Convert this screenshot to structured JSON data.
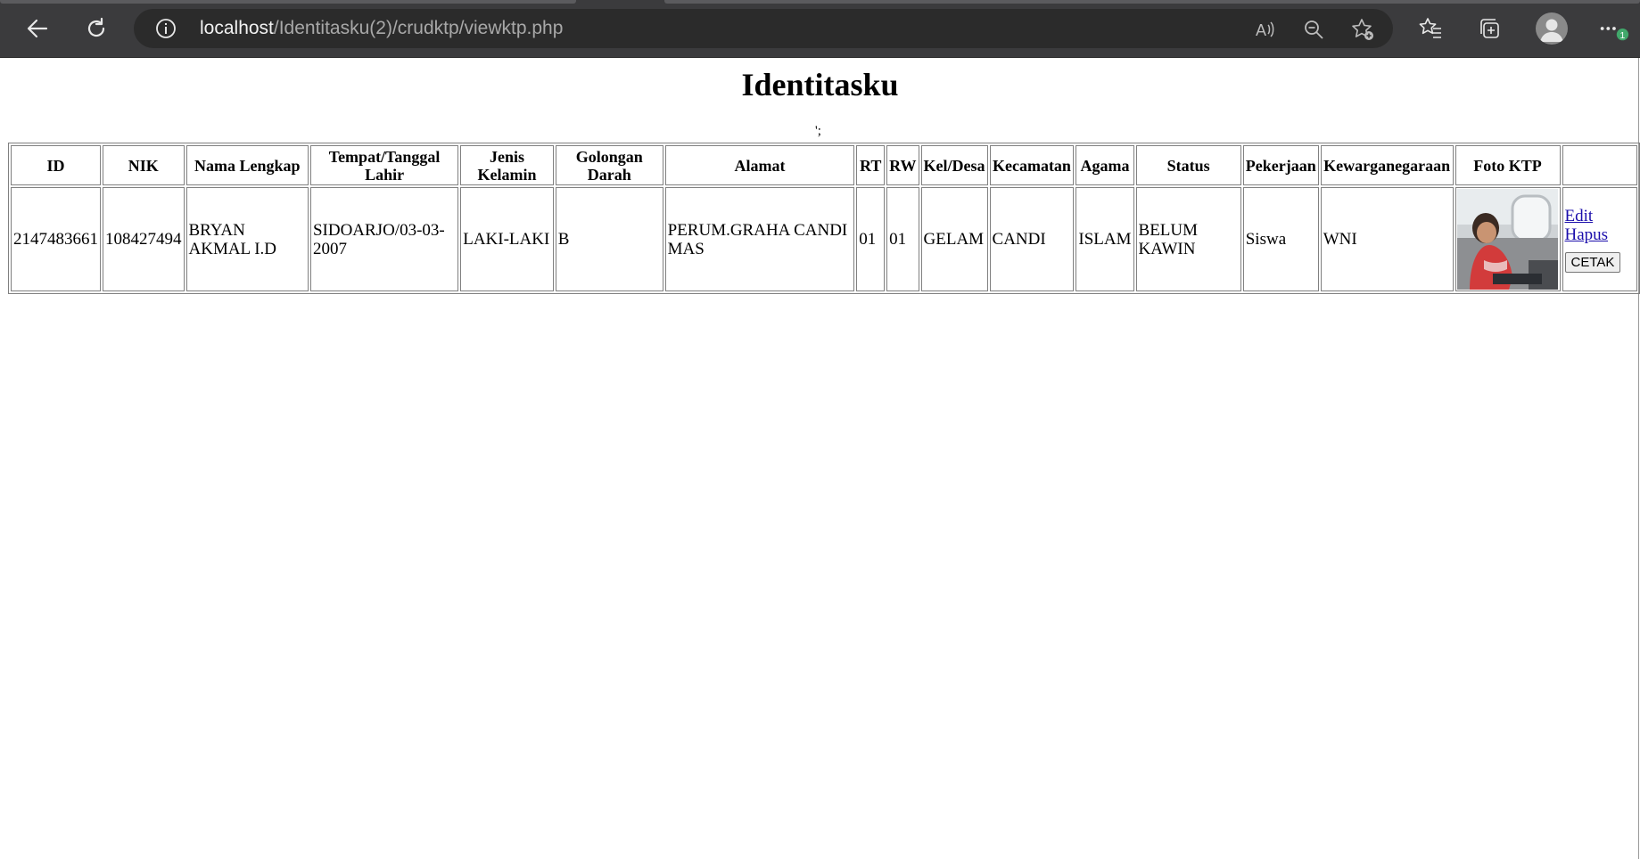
{
  "browser": {
    "url_host": "localhost",
    "url_path": "/Identitasku(2)/crudktp/viewktp.php",
    "notification_badge": "1"
  },
  "page": {
    "title": "Identitasku",
    "stray_text": "';"
  },
  "table": {
    "headers": [
      "ID",
      "NIK",
      "Nama Lengkap",
      "Tempat/Tanggal Lahir",
      "Jenis Kelamin",
      "Golongan Darah",
      "Alamat",
      "RT",
      "RW",
      "Kel/Desa",
      "Kecamatan",
      "Agama",
      "Status",
      "Pekerjaan",
      "Kewarganegaraan",
      "Foto KTP",
      ""
    ],
    "rows": [
      {
        "id": "2147483661",
        "nik": "108427494",
        "nama": "BRYAN AKMAL I.D",
        "ttl": "SIDOARJO/03-03-2007",
        "jk": "LAKI-LAKI",
        "goldar": "B",
        "alamat": "PERUM.GRAHA CANDI MAS",
        "rt": "01",
        "rw": "01",
        "kel": "GELAM",
        "kec": "CANDI",
        "agama": "ISLAM",
        "status": "BELUM KAWIN",
        "pekerjaan": "Siswa",
        "wn": "WNI",
        "edit": "Edit",
        "hapus": "Hapus",
        "cetak": "CETAK"
      }
    ]
  }
}
